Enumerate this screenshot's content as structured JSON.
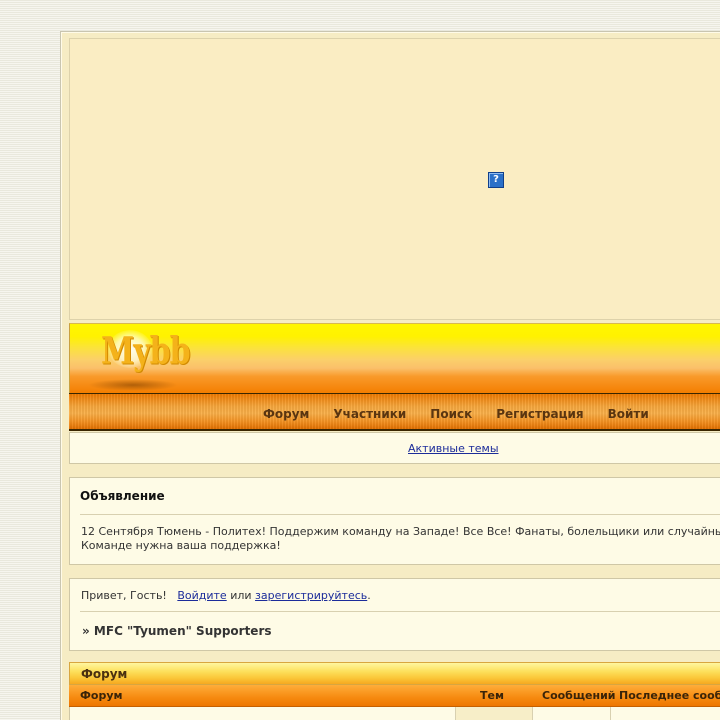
{
  "banner": {
    "icon": "?"
  },
  "header": {
    "logo": "Mybb"
  },
  "nav": {
    "items": [
      {
        "label": "Форум"
      },
      {
        "label": "Участники"
      },
      {
        "label": "Поиск"
      },
      {
        "label": "Регистрация"
      },
      {
        "label": "Войти"
      }
    ]
  },
  "links": {
    "active_topics": "Активные темы"
  },
  "announcement": {
    "title": "Объявление",
    "line1": "12 Сентября Тюмень - Политех! Поддержим команду на Западе! Все Все! Фанаты, болельщики или случайны",
    "line2": "Команде нужна ваша поддержка!"
  },
  "welcome": {
    "greeting": "Привет, Гость!",
    "login_link": "Войдите",
    "or": "или",
    "register_link": "зарегистрируйтесь",
    "period": ".",
    "breadcrumb": "» MFC \"Tyumen\" Supporters"
  },
  "forum_table": {
    "section_title": "Форум",
    "columns": {
      "forum": "Форум",
      "topics": "Тем",
      "posts": "Сообщений",
      "last_post": "Последнее сооб"
    }
  },
  "colors": {
    "header_yellow": "#fff200",
    "nav_orange": "#f39020",
    "page_bg": "#f6ecc4",
    "link": "#1c2c9a"
  }
}
